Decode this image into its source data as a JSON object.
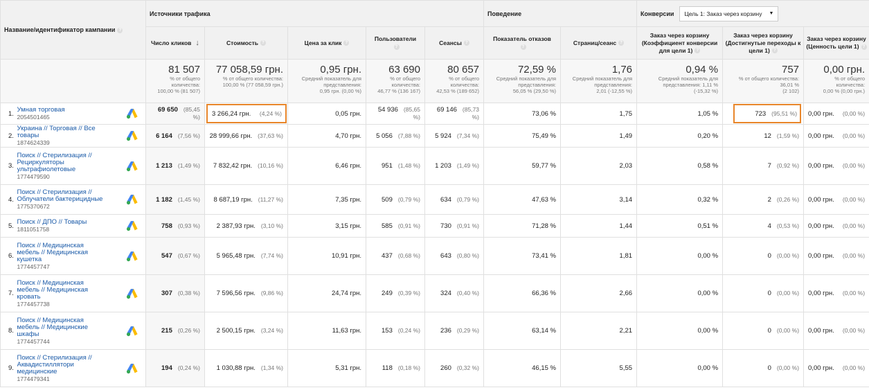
{
  "groups": {
    "traffic": "Источники трафика",
    "behavior": "Поведение",
    "conversions": "Конверсии",
    "goal_select": "Цель 1: Заказ через корзину"
  },
  "columns": {
    "name": "Название/идентификатор кампании",
    "clicks": "Число кликов",
    "cost": "Стоимость",
    "cpc": "Цена за клик",
    "users": "Пользователи",
    "sessions": "Сеансы",
    "bounce": "Показатель отказов",
    "pages": "Страниц/сеанс",
    "conv_rate": "Заказ через корзину (Коэффициент конверсии для цели 1)",
    "goal_compl": "Заказ через корзину (Достигнутые переходы к цели 1)",
    "goal_value": "Заказ через корзину (Ценность цели 1)"
  },
  "totals": {
    "clicks": {
      "big": "81 507",
      "s1": "% от общего количества:",
      "s2": "100,00 % (81 507)"
    },
    "cost": {
      "big": "77 058,59 грн.",
      "s1": "% от общего количества:",
      "s2": "100,00 % (77 058,59 грн.)"
    },
    "cpc": {
      "big": "0,95 грн.",
      "s1": "Средний показатель для представления:",
      "s2": "0,95 грн. (0,00 %)"
    },
    "users": {
      "big": "63 690",
      "s1": "% от общего количества:",
      "s2": "46,77 % (136 167)"
    },
    "sessions": {
      "big": "80 657",
      "s1": "% от общего количества:",
      "s2": "42,53 % (189 652)"
    },
    "bounce": {
      "big": "72,59 %",
      "s1": "Средний показатель для представления:",
      "s2": "56,05 % (29,50 %)"
    },
    "pages": {
      "big": "1,76",
      "s1": "Средний показатель для представления:",
      "s2": "2,01 (-12,55 %)"
    },
    "conv_rate": {
      "big": "0,94 %",
      "s1": "Средний показатель для представления: 1,11 %",
      "s2": "(-15,32 %)"
    },
    "goal_compl": {
      "big": "757",
      "s1": "% от общего количества: 36,01 %",
      "s2": "(2 102)"
    },
    "goal_value": {
      "big": "0,00 грн.",
      "s1": "% от общего количества:",
      "s2": "0,00 % (0,00 грн.)"
    }
  },
  "rows": [
    {
      "idx": "1.",
      "name": [
        "Умная торговая"
      ],
      "id": "2054501465",
      "clicks": "69 650",
      "clicks_pct": "(85,45 %)",
      "cost": "3 266,24 грн.",
      "cost_pct": "(4,24 %)",
      "cpc": "0,05 грн.",
      "users": "54 936",
      "users_pct": "(85,65 %)",
      "sessions": "69 146",
      "sessions_pct": "(85,73 %)",
      "bounce": "73,06 %",
      "pages": "1,75",
      "conv_rate": "1,05 %",
      "goal": "723",
      "goal_pct": "(95,51 %)",
      "value": "0,00 грн.",
      "value_pct": "(0,00 %)"
    },
    {
      "idx": "2.",
      "name": [
        "Украина // Торговая // Все",
        "товары"
      ],
      "id": "1874624339",
      "clicks": "6 164",
      "clicks_pct": "(7,56 %)",
      "cost": "28 999,66 грн.",
      "cost_pct": "(37,63 %)",
      "cpc": "4,70 грн.",
      "users": "5 056",
      "users_pct": "(7,88 %)",
      "sessions": "5 924",
      "sessions_pct": "(7,34 %)",
      "bounce": "75,49 %",
      "pages": "1,49",
      "conv_rate": "0,20 %",
      "goal": "12",
      "goal_pct": "(1,59 %)",
      "value": "0,00 грн.",
      "value_pct": "(0,00 %)"
    },
    {
      "idx": "3.",
      "name": [
        "Поиск // Стерилизация //",
        "Рециркуляторы",
        "ультрафиолетовые"
      ],
      "id": "1774479590",
      "clicks": "1 213",
      "clicks_pct": "(1,49 %)",
      "cost": "7 832,42 грн.",
      "cost_pct": "(10,16 %)",
      "cpc": "6,46 грн.",
      "users": "951",
      "users_pct": "(1,48 %)",
      "sessions": "1 203",
      "sessions_pct": "(1,49 %)",
      "bounce": "59,77 %",
      "pages": "2,03",
      "conv_rate": "0,58 %",
      "goal": "7",
      "goal_pct": "(0,92 %)",
      "value": "0,00 грн.",
      "value_pct": "(0,00 %)"
    },
    {
      "idx": "4.",
      "name": [
        "Поиск // Стерилизация //",
        "Облучатели бактерицидные"
      ],
      "id": "1775370672",
      "clicks": "1 182",
      "clicks_pct": "(1,45 %)",
      "cost": "8 687,19 грн.",
      "cost_pct": "(11,27 %)",
      "cpc": "7,35 грн.",
      "users": "509",
      "users_pct": "(0,79 %)",
      "sessions": "634",
      "sessions_pct": "(0,79 %)",
      "bounce": "47,63 %",
      "pages": "3,14",
      "conv_rate": "0,32 %",
      "goal": "2",
      "goal_pct": "(0,26 %)",
      "value": "0,00 грн.",
      "value_pct": "(0,00 %)"
    },
    {
      "idx": "5.",
      "name": [
        "Поиск // ДПО // Товары"
      ],
      "id": "1811051758",
      "clicks": "758",
      "clicks_pct": "(0,93 %)",
      "cost": "2 387,93 грн.",
      "cost_pct": "(3,10 %)",
      "cpc": "3,15 грн.",
      "users": "585",
      "users_pct": "(0,91 %)",
      "sessions": "730",
      "sessions_pct": "(0,91 %)",
      "bounce": "71,28 %",
      "pages": "1,44",
      "conv_rate": "0,51 %",
      "goal": "4",
      "goal_pct": "(0,53 %)",
      "value": "0,00 грн.",
      "value_pct": "(0,00 %)"
    },
    {
      "idx": "6.",
      "name": [
        "Поиск // Медицинская",
        "мебель // Медицинская",
        "кушетка"
      ],
      "id": "1774457747",
      "clicks": "547",
      "clicks_pct": "(0,67 %)",
      "cost": "5 965,48 грн.",
      "cost_pct": "(7,74 %)",
      "cpc": "10,91 грн.",
      "users": "437",
      "users_pct": "(0,68 %)",
      "sessions": "643",
      "sessions_pct": "(0,80 %)",
      "bounce": "73,41 %",
      "pages": "1,81",
      "conv_rate": "0,00 %",
      "goal": "0",
      "goal_pct": "(0,00 %)",
      "value": "0,00 грн.",
      "value_pct": "(0,00 %)"
    },
    {
      "idx": "7.",
      "name": [
        "Поиск // Медицинская",
        "мебель // Медицинская",
        "кровать"
      ],
      "id": "1774457738",
      "clicks": "307",
      "clicks_pct": "(0,38 %)",
      "cost": "7 596,56 грн.",
      "cost_pct": "(9,86 %)",
      "cpc": "24,74 грн.",
      "users": "249",
      "users_pct": "(0,39 %)",
      "sessions": "324",
      "sessions_pct": "(0,40 %)",
      "bounce": "66,36 %",
      "pages": "2,66",
      "conv_rate": "0,00 %",
      "goal": "0",
      "goal_pct": "(0,00 %)",
      "value": "0,00 грн.",
      "value_pct": "(0,00 %)"
    },
    {
      "idx": "8.",
      "name": [
        "Поиск // Медицинская",
        "мебель // Медицинские",
        "шкафы"
      ],
      "id": "1774457744",
      "clicks": "215",
      "clicks_pct": "(0,26 %)",
      "cost": "2 500,15 грн.",
      "cost_pct": "(3,24 %)",
      "cpc": "11,63 грн.",
      "users": "153",
      "users_pct": "(0,24 %)",
      "sessions": "236",
      "sessions_pct": "(0,29 %)",
      "bounce": "63,14 %",
      "pages": "2,21",
      "conv_rate": "0,00 %",
      "goal": "0",
      "goal_pct": "(0,00 %)",
      "value": "0,00 грн.",
      "value_pct": "(0,00 %)"
    },
    {
      "idx": "9.",
      "name": [
        "Поиск // Стерилизация //",
        "Аквадистиллятори",
        "медицинские"
      ],
      "id": "1774479341",
      "clicks": "194",
      "clicks_pct": "(0,24 %)",
      "cost": "1 030,88 грн.",
      "cost_pct": "(1,34 %)",
      "cpc": "5,31 грн.",
      "users": "118",
      "users_pct": "(0,18 %)",
      "sessions": "260",
      "sessions_pct": "(0,32 %)",
      "bounce": "46,15 %",
      "pages": "5,55",
      "conv_rate": "0,00 %",
      "goal": "0",
      "goal_pct": "(0,00 %)",
      "value": "0,00 грн.",
      "value_pct": "(0,00 %)"
    }
  ]
}
